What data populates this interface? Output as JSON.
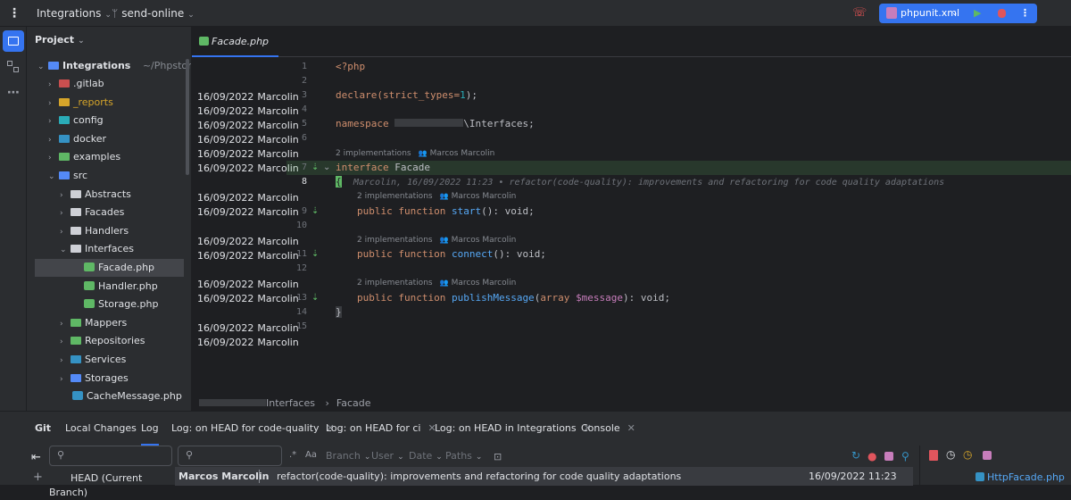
{
  "titlebar": {
    "menu_icon": "kebab-menu-icon",
    "project_name": "Integrations",
    "branch_icon": "git-branch-icon",
    "branch_name": "send-online",
    "run_config": "phpunit.xml",
    "colors": {
      "accent": "#3574f0"
    }
  },
  "project_panel": {
    "title": "Project",
    "root": {
      "name": "Integrations",
      "path": "~/PhpstormProje"
    },
    "items": [
      {
        "label": ".gitlab",
        "color": "#c94f4f"
      },
      {
        "label": "_reports",
        "color": "#d6a52a"
      },
      {
        "label": "config",
        "color": "#2aacb8"
      },
      {
        "label": "docker",
        "color": "#3592c4"
      },
      {
        "label": "examples",
        "color": "#5fb865"
      },
      {
        "label": "src",
        "color": "#548af7"
      },
      {
        "label": "Abstracts"
      },
      {
        "label": "Facades"
      },
      {
        "label": "Handlers"
      },
      {
        "label": "Interfaces"
      },
      {
        "label": "Facade.php"
      },
      {
        "label": "Handler.php"
      },
      {
        "label": "Storage.php"
      },
      {
        "label": "Mappers",
        "color": "#5fb865"
      },
      {
        "label": "Repositories",
        "color": "#5fb865"
      },
      {
        "label": "Services",
        "color": "#3592c4"
      },
      {
        "label": "Storages",
        "color": "#548af7"
      },
      {
        "label": "CacheMessage.php"
      }
    ]
  },
  "editor": {
    "tab": "Facade.php",
    "annotations": {
      "date": "16/09/2022",
      "author": "Marcolin"
    },
    "line_numbers": [
      "1",
      "2",
      "3",
      "4",
      "5",
      "6",
      "7",
      "8",
      "9",
      "10",
      "11",
      "12",
      "13",
      "14",
      "15"
    ],
    "hints": {
      "implementations": "2 implementations",
      "author": "Marcos Marcolin"
    },
    "code": {
      "l1": "<?php",
      "l3_a": "declare(strict_types=",
      "l3_num": "1",
      "l3_b": ");",
      "l5_kw": "namespace",
      "l5_ns": "\\Interfaces;",
      "l7_kw": "interface",
      "l7_name": "Facade",
      "l8": "{",
      "l8_blame": "Marcolin, 16/09/2022 11:23 • refactor(code-quality): improvements and refactoring for code quality adaptations",
      "pub": "public function",
      "m1": "start",
      "m2": "connect",
      "m3": "publishMessage",
      "paren_open": "(",
      "paren_close": "): void;",
      "m3_type": "array",
      "m3_var": "$message",
      "l14": "}"
    },
    "breadcrumb": [
      "Interfaces",
      "Facade"
    ]
  },
  "bottom": {
    "tabs": [
      "Git",
      "Local Changes",
      "Log",
      "Log: on HEAD for code-quality",
      "Log: on HEAD for ci",
      "Log: on HEAD in Integrations",
      "Console"
    ],
    "filters": [
      "Branch",
      "User",
      "Date",
      "Paths"
    ],
    "branch": "HEAD (Current Branch)",
    "commit": {
      "author": "Marcos Marcolin",
      "message": "refactor(code-quality): improvements and refactoring for code quality adaptations",
      "date": "16/09/2022 11:23"
    },
    "changed_file": "HttpFacade.php"
  }
}
